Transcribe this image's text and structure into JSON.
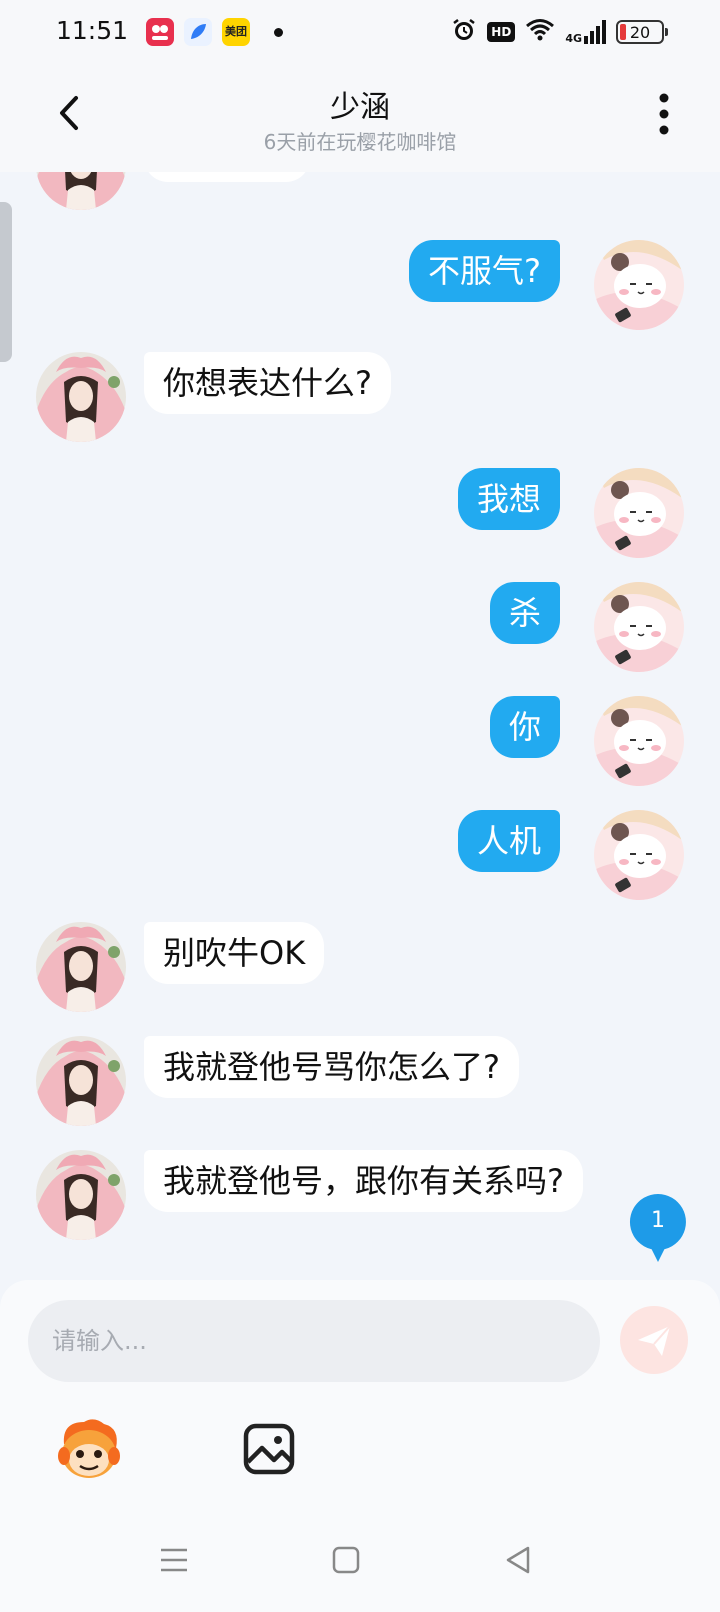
{
  "status_bar": {
    "time": "11:51",
    "apps": [
      {
        "name": "photo-app",
        "label": "",
        "color": "#e8304e"
      },
      {
        "name": "feather-app",
        "label": "",
        "color": "#2f7cf6"
      },
      {
        "name": "meituan-app",
        "label": "美团",
        "color": "#ffd400"
      }
    ],
    "hd": "HD",
    "network": "4G",
    "battery": "20",
    "battery_color": "#e5393a"
  },
  "header": {
    "title": "少涵",
    "subtitle": "6天前在玩樱花咖啡馆"
  },
  "messages": [
    {
      "side": "right",
      "text": "不服气?"
    },
    {
      "side": "left",
      "text": "你想表达什么?"
    },
    {
      "side": "right",
      "text": "我想"
    },
    {
      "side": "right",
      "text": "杀"
    },
    {
      "side": "right",
      "text": "你"
    },
    {
      "side": "right",
      "text": "人机"
    },
    {
      "side": "left",
      "text": "别吹牛OK"
    },
    {
      "side": "left",
      "text": "我就登他号骂你怎么了?"
    },
    {
      "side": "left",
      "text": "我就登他号，跟你有关系吗?"
    }
  ],
  "unread_count": "1",
  "composer": {
    "placeholder": "请输入..."
  },
  "colors": {
    "sent_bubble": "#22aaf0",
    "received_bubble": "#ffffff",
    "background": "#f2f5fa",
    "send_button": "#fde4e1"
  },
  "icons": {
    "back": "chevron-left-icon",
    "more": "more-vertical-icon",
    "send": "paper-plane-icon",
    "emoji": "cartoon-face-icon",
    "image": "image-icon",
    "nav_menu": "menu-icon",
    "nav_home": "square-icon",
    "nav_back": "triangle-back-icon"
  }
}
